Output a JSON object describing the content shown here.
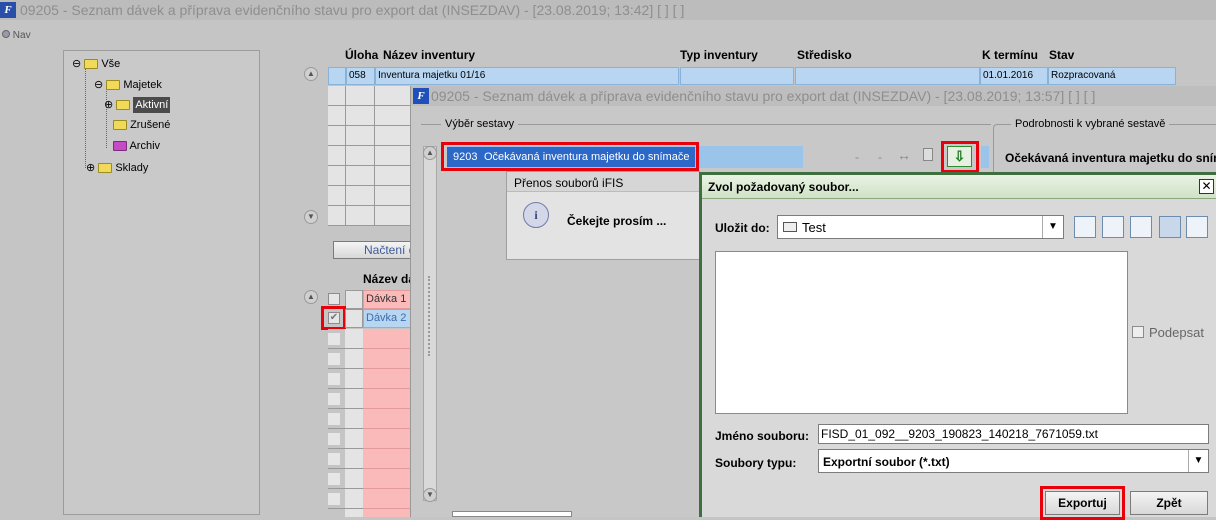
{
  "main_window": {
    "title": "09205 - Seznam dávek a příprava evidenčního stavu pro export dat (INSEZDAV) - [23.08.2019; 13:42]  [ ]  [ ]",
    "nav_label": "Nav"
  },
  "tree": [
    {
      "label": "Vše"
    },
    {
      "label": "Majetek"
    },
    {
      "label": "Aktivní"
    },
    {
      "label": "Zrušené"
    },
    {
      "label": "Archiv"
    },
    {
      "label": "Sklady"
    }
  ],
  "top_table": {
    "headers": [
      "Úloha",
      "Název inventury",
      "Typ inventury",
      "Středisko",
      "K termínu",
      "Stav"
    ],
    "row": {
      "uloha": "058",
      "nazev": "Inventura majetku 01/16",
      "typ": "",
      "stredisko": "",
      "termin": "01.01.2016",
      "stav": "Rozpracovaná"
    }
  },
  "load_button": "Načtení d",
  "batch_table": {
    "header": "Název dá",
    "rows": [
      "Dávka 1",
      "Dávka 2"
    ]
  },
  "second_window": {
    "title": "09205 - Seznam dávek a příprava evidenčního stavu pro export dat (INSEZDAV) - [23.08.2019; 13:57]  [ ]  [ ]",
    "section_left": "Výběr sestavy",
    "section_right": "Podrobnosti k vybrané sestavě",
    "selected_code": "9203",
    "selected_name": "Očekávaná inventura majetku do snímače",
    "detail_title": "Očekávaná inventura majetku do snímá",
    "dash1": "-",
    "dash2": "-"
  },
  "transfer_dialog": {
    "title": "Přenos souborů iFIS",
    "message": "Čekejte prosím ..."
  },
  "file_dialog": {
    "title": "Zvol požadovaný soubor...",
    "save_in_label": "Uložit do:",
    "folder": "Test",
    "sign_label": "Podepsat",
    "filename_label": "Jméno souboru:",
    "filename_value": "FISD_01_092__9203_190823_140218_7671059.txt",
    "filetype_label": "Soubory typu:",
    "filetype_value": "Exportní soubor (*.txt)",
    "export_button": "Exportuj",
    "back_button": "Zpět"
  }
}
